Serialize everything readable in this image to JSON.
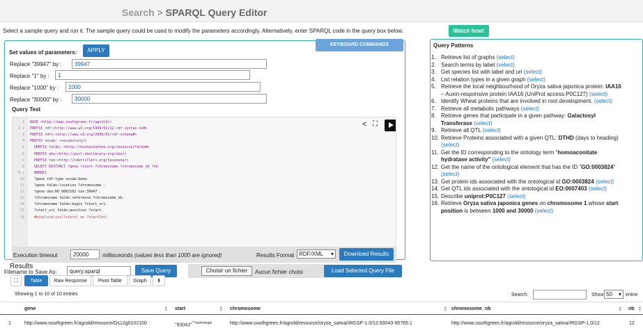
{
  "header": {
    "title_prefix": "Search > ",
    "title_strong": "SPARQL Query Editor"
  },
  "intro": {
    "text": "Select a sample query and run it. The sample query could be used to modify the parameters accordingly. Alternatively, enter SPARQL code in the query box below.",
    "watch_button": "Watch how!"
  },
  "params": {
    "heading": "Set values of parameters:",
    "apply_label": "APPLY",
    "keyboard_label": "KEYBOARD COMMANDS",
    "rows": [
      {
        "label": "Replace \"39947\" by :",
        "value": "39947"
      },
      {
        "label": "Replace \"1\" by :",
        "value": "1"
      },
      {
        "label": "Replace \"1000\" by :",
        "value": "1000"
      },
      {
        "label": "Replace \"30000\" by :",
        "value": "30000"
      }
    ]
  },
  "query": {
    "heading": "Query Text",
    "lines": [
      {
        "n": "1",
        "text": "BASE <http://www.southgreen.fr/agrold/>"
      },
      {
        "n": "2 ▾",
        "text": "PREFIX rdf:<http://www.w3.org/1999/02/22-rdf-syntax-ns#>"
      },
      {
        "n": "3",
        "text": "PREFIX rdfs:<http://www.w3.org/2000/01/rdf-schema#>"
      },
      {
        "n": "4",
        "text": "PREFIX vocab: <vocabulary/>"
      },
      {
        "n": "5",
        "text": "  PREFIX faldo: <http://biohackathon.org/resource/faldo#>"
      },
      {
        "n": "6",
        "text": "  PREFIX obo:<http://purl.obolibrary.org/obo/>"
      },
      {
        "n": "7",
        "text": "  PREFIX tax:<http://identifiers.org/taxonomy/>"
      },
      {
        "n": "8",
        "text": "  SELECT DISTINCT ?gene ?start ?chromosome ?chromosome_nb ?nb"
      },
      {
        "n": "9 ▾",
        "text": "  WHERE{"
      },
      {
        "n": "10",
        "text": "  ?gene rdf:type vocab:Gene."
      },
      {
        "n": "11",
        "text": "  ?gene faldo:location ?chromosome ."
      },
      {
        "n": "12",
        "text": "  ?gene obo:RO_0002162 tax:39947 ."
      },
      {
        "n": "13",
        "text": "  ?chromosome faldo:reference ?chromosome_nb."
      },
      {
        "n": "14",
        "text": "  ?chromosome faldo:begin ?start_uri."
      },
      {
        "n": "15",
        "text": "  ?start_uri faldo:position ?start."
      },
      {
        "n": "16",
        "text": "  #bind(xsd:int(?start) as ?startInt)"
      }
    ],
    "exec_label": "Execution timeout",
    "exec_value": "20000",
    "exec_unit": "millisceonds",
    "exec_note": "(values less than 1000 are ignored)",
    "format_label": "Results Format",
    "format_value": "RDF/XML",
    "download_label": "Download Results",
    "filename_label": "Filename to Save As:",
    "filename_value": "query.sparql",
    "save_label": "Save Query",
    "choose_label": "Choisir un fichier",
    "no_file_label": "Aucun fichier choisi",
    "load_label": "Load Selected Query File"
  },
  "patterns": {
    "heading": "Query Patterns",
    "select": "(select)",
    "items": [
      {
        "n": "1.",
        "parts": [
          {
            "t": "Retrieve list of graphs "
          }
        ]
      },
      {
        "n": "2.",
        "parts": [
          {
            "t": "Search terms by label "
          }
        ]
      },
      {
        "n": "3.",
        "parts": [
          {
            "t": "Get species list with label and uri "
          }
        ]
      },
      {
        "n": "4.",
        "parts": [
          {
            "t": "List relation types in a given graph "
          }
        ]
      },
      {
        "n": "5.",
        "parts": [
          {
            "t": "Retrieve the local neighbourhood of Oryza sativa japonica protein: "
          },
          {
            "t": "IAA16",
            "b": true
          }
        ],
        "noselect": true
      },
      {
        "n": "",
        "parts": [
          {
            "t": "– Auxin-responsive protein IAA16 (UniProt access:P0C127) "
          }
        ]
      },
      {
        "n": "6.",
        "parts": [
          {
            "t": "Identify Wheat proteins that are involved in root development. "
          }
        ]
      },
      {
        "n": "7.",
        "parts": [
          {
            "t": "Retrieve all metabolic pathways "
          }
        ]
      },
      {
        "n": "8.",
        "parts": [
          {
            "t": "Retrieve genes that participate in a given pathway: "
          },
          {
            "t": "Galactosyl",
            "b": true
          }
        ],
        "noselect": true
      },
      {
        "n": "",
        "parts": [
          {
            "t": "Transferase",
            "b": true
          },
          {
            "t": " "
          }
        ]
      },
      {
        "n": "9.",
        "parts": [
          {
            "t": "Retrieve all QTL "
          }
        ]
      },
      {
        "n": "10.",
        "parts": [
          {
            "t": "Retrieve Proteins associated with a given QTL: "
          },
          {
            "t": "DTHD",
            "b": true
          },
          {
            "t": " (days to heading)"
          }
        ],
        "noselect": true
      },
      {
        "n": "",
        "parts": []
      },
      {
        "n": "11.",
        "parts": [
          {
            "t": "Get the ID corresponding to the ontology term \""
          },
          {
            "t": "homoaconitate",
            "b": true
          }
        ],
        "noselect": true
      },
      {
        "n": "",
        "parts": [
          {
            "t": "hydratase activity\"",
            "b": true
          },
          {
            "t": " "
          }
        ]
      },
      {
        "n": "12.",
        "parts": [
          {
            "t": "Get the name of the ontological element that has the ID \""
          },
          {
            "t": "GO:0003824",
            "b": true
          },
          {
            "t": "\""
          }
        ],
        "noselect": true
      },
      {
        "n": "",
        "parts": []
      },
      {
        "n": "13.",
        "parts": [
          {
            "t": "Get protein ids associated with the ontological id "
          },
          {
            "t": "GO:0003824",
            "b": true
          },
          {
            "t": " "
          }
        ]
      },
      {
        "n": "14.",
        "parts": [
          {
            "t": "Get QTL ids associated with the ontological id "
          },
          {
            "t": "EO:0007403",
            "b": true
          },
          {
            "t": " "
          }
        ]
      },
      {
        "n": "15.",
        "parts": [
          {
            "t": "Describe "
          },
          {
            "t": "uniprot:P0C127",
            "b": true
          },
          {
            "t": " "
          }
        ]
      },
      {
        "n": "16.",
        "parts": [
          {
            "t": "Retrieve "
          },
          {
            "t": "Oryza sativa japonica genes",
            "b": true
          },
          {
            "t": " on "
          },
          {
            "t": "chromosome 1",
            "b": true
          },
          {
            "t": " whose "
          },
          {
            "t": "start",
            "b": true
          }
        ],
        "noselect": true
      },
      {
        "n": "",
        "parts": [
          {
            "t": "position",
            "b": true
          },
          {
            "t": " is between "
          },
          {
            "t": "1000 and 30000",
            "b": true
          },
          {
            "t": " "
          }
        ]
      }
    ]
  },
  "results": {
    "heading": "Results",
    "tabs": [
      "Table",
      "Raw Response",
      "Pivot Table",
      "Graph"
    ],
    "showing": "Showing 1 to 10 of 10 entries",
    "search_label": "Search:",
    "show_label": "Show",
    "show_value": "50",
    "entries_label": "entrie",
    "columns": [
      "gene",
      "start",
      "chromosome",
      "chromosome_nb",
      "nb"
    ],
    "row": {
      "idx": "1",
      "gene": "http://www.southgreen.fr/agrold/resource/Os12g0102100",
      "start": "\"93043\"",
      "start_type": "^^xsd:integer",
      "chromosome": "http://www.southgreen.fr/agrold/resource/oryza_sativa/IRGSP-1.0/12:93043-95765:1",
      "chromosome_nb": "http://www.southgreen.fr/agrold/resource/oryza_sativa/IRGSP-1.0/12",
      "nb": "12"
    }
  }
}
